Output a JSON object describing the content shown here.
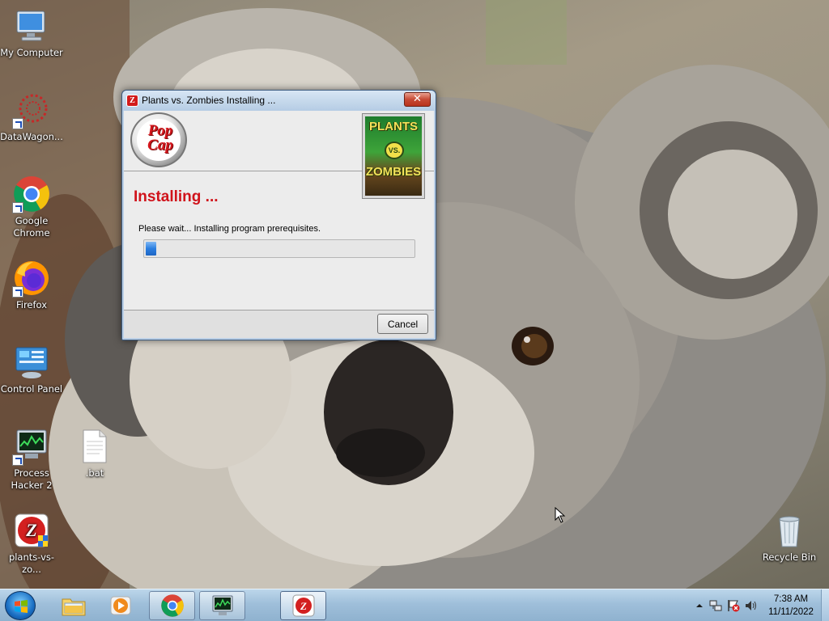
{
  "desktop": {
    "icons": [
      {
        "label": "My Computer",
        "icon": "computer-icon"
      },
      {
        "label": "DataWagon...",
        "icon": "datawagon-icon"
      },
      {
        "label": "Google Chrome",
        "icon": "chrome-icon"
      },
      {
        "label": "Firefox",
        "icon": "firefox-icon"
      },
      {
        "label": "Control Panel",
        "icon": "control-panel-icon"
      },
      {
        "label": "Process Hacker 2",
        "icon": "process-hacker-icon"
      },
      {
        "label": ".bat",
        "icon": "bat-file-icon"
      },
      {
        "label": "plants-vs-zo...",
        "icon": "pvz-installer-icon"
      },
      {
        "label": "Recycle Bin",
        "icon": "recycle-bin-icon"
      }
    ]
  },
  "installer": {
    "title": "Plants vs. Zombies Installing ...",
    "close_label": "✕",
    "logo_text": "Pop Cap",
    "art_title_top": "PLANTS",
    "art_vs": "VS.",
    "art_title_bottom": "ZOMBIES",
    "heading": "Installing ...",
    "subtext": "Please wait... Installing program prerequisites.",
    "progress": 0.04,
    "cancel_label": "Cancel",
    "colors": {
      "heading": "#d0131b",
      "progress": "#2a7ee0"
    }
  },
  "taskbar": {
    "buttons": [
      {
        "name": "explorer",
        "icon": "folder-icon",
        "state": "pinned"
      },
      {
        "name": "media-player",
        "icon": "media-player-icon",
        "state": "pinned"
      },
      {
        "name": "chrome",
        "icon": "chrome-icon",
        "state": "open"
      },
      {
        "name": "process-hacker",
        "icon": "process-hacker-icon",
        "state": "open"
      },
      {
        "name": "pvz-installer",
        "icon": "pvz-installer-icon",
        "state": "active"
      }
    ],
    "clock_time": "7:38 AM",
    "clock_date": "11/11/2022"
  }
}
